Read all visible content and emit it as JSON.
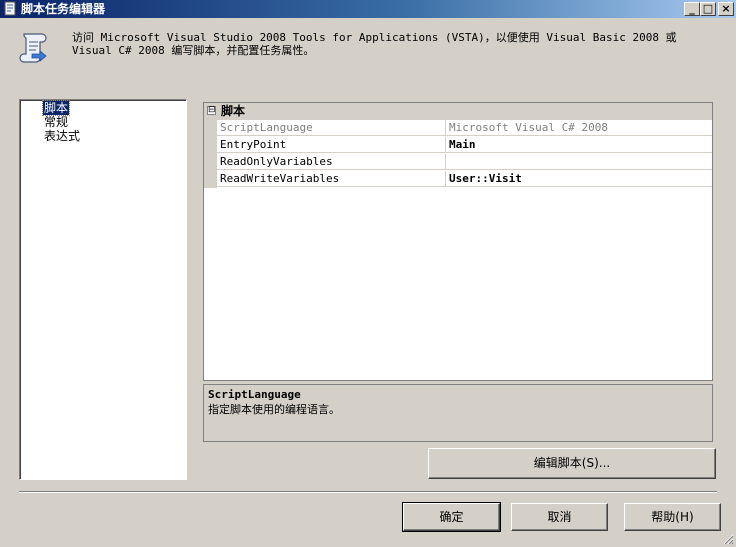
{
  "window": {
    "title": "脚本任务编辑器",
    "minimize_glyph": "_",
    "maximize_glyph": "□",
    "close_glyph": "×"
  },
  "header": {
    "icon": "script-scroll-icon",
    "description": "访问 Microsoft Visual Studio 2008 Tools for Applications (VSTA)，以便使用 Visual Basic 2008 或 Visual C# 2008 编写脚本，并配置任务属性。"
  },
  "nav": {
    "items": [
      {
        "label": "脚本",
        "selected": true
      },
      {
        "label": "常规",
        "selected": false
      },
      {
        "label": "表达式",
        "selected": false
      }
    ]
  },
  "property_grid": {
    "category": {
      "expander": "⊟",
      "label": "脚本"
    },
    "rows": [
      {
        "name": "ScriptLanguage",
        "value": "Microsoft Visual C# 2008",
        "readonly": true
      },
      {
        "name": "EntryPoint",
        "value": "Main",
        "readonly": false
      },
      {
        "name": "ReadOnlyVariables",
        "value": "",
        "readonly": false
      },
      {
        "name": "ReadWriteVariables",
        "value": "User::Visit",
        "readonly": false
      }
    ]
  },
  "description": {
    "title": "ScriptLanguage",
    "text": "指定脚本使用的编程语言。"
  },
  "buttons": {
    "edit_script": "编辑脚本(S)...",
    "ok": "确定",
    "cancel": "取消",
    "help": "帮助(H)"
  },
  "colors": {
    "window_bg": "#d4d0c8",
    "selection": "#0a246a",
    "titlebar_start": "#0a246a",
    "titlebar_end": "#a6caf0"
  }
}
